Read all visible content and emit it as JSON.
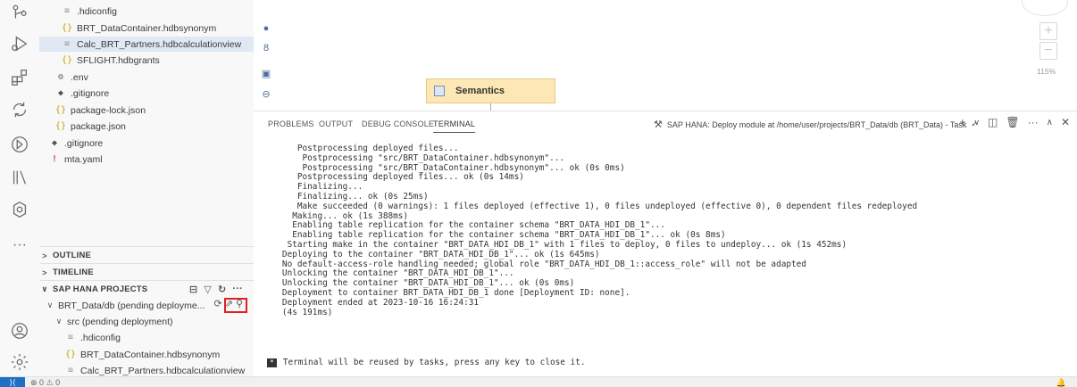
{
  "explorer": {
    "top_items": [
      {
        "icon": "≡",
        "kind": "gen",
        "label": ".hdiconfig"
      },
      {
        "icon": "{}",
        "kind": "json",
        "label": "BRT_DataContainer.hdbsynonym"
      },
      {
        "icon": "≡",
        "kind": "gen",
        "label": "Calc_BRT_Partners.hdbcalculationview"
      },
      {
        "icon": "{}",
        "kind": "json",
        "label": "SFLIGHT.hdbgrants"
      },
      {
        "icon": "⚙",
        "kind": "gear",
        "label": ".env"
      },
      {
        "icon": "◆",
        "kind": "diamond",
        "label": ".gitignore"
      },
      {
        "icon": "{}",
        "kind": "json",
        "label": "package-lock.json"
      },
      {
        "icon": "{}",
        "kind": "json",
        "label": "package.json"
      },
      {
        "icon": "◆",
        "kind": "diamond",
        "label": ".gitignore"
      },
      {
        "icon": "!",
        "kind": "excl",
        "label": "mta.yaml"
      }
    ],
    "outline_label": "OUTLINE",
    "timeline_label": "TIMELINE",
    "sap_hana_label": "SAP HANA PROJECTS",
    "project_label": "BRT_Data/db (pending deployme...",
    "src_label": "src (pending deployment)",
    "bottom_items": [
      {
        "icon": "≡",
        "kind": "gen",
        "label": ".hdiconfig"
      },
      {
        "icon": "{}",
        "kind": "json",
        "label": "BRT_DataContainer.hdbsynonym"
      },
      {
        "icon": "≡",
        "kind": "gen",
        "label": "Calc_BRT_Partners.hdbcalculationview"
      }
    ]
  },
  "canvas": {
    "semantics_label": "Semantics",
    "zoom_level": "115%"
  },
  "panel": {
    "tabs": [
      "PROBLEMS",
      "OUTPUT",
      "DEBUG CONSOLE",
      "TERMINAL"
    ],
    "active_tab": "TERMINAL",
    "task_title": "SAP HANA: Deploy module at /home/user/projects/BRT_Data/db (BRT_Data) - Task"
  },
  "terminal": {
    "lines": [
      "      Postprocessing deployed files...",
      "       Postprocessing \"src/BRT_DataContainer.hdbsynonym\"...",
      "       Postprocessing \"src/BRT_DataContainer.hdbsynonym\"... ok (0s 0ms)",
      "      Postprocessing deployed files... ok (0s 14ms)",
      "      Finalizing...",
      "      Finalizing... ok (0s 25ms)",
      "      Make succeeded (0 warnings): 1 files deployed (effective 1), 0 files undeployed (effective 0), 0 dependent files redeployed",
      "     Making... ok (1s 388ms)",
      "     Enabling table replication for the container schema \"BRT_DATA_HDI_DB_1\"...",
      "     Enabling table replication for the container schema \"BRT_DATA_HDI_DB_1\"... ok (0s 8ms)",
      "    Starting make in the container \"BRT_DATA_HDI_DB_1\" with 1 files to deploy, 0 files to undeploy... ok (1s 452ms)",
      "   Deploying to the container \"BRT_DATA_HDI_DB_1\"... ok (1s 645ms)",
      "   No default-access-role handling needed; global role \"BRT_DATA_HDI_DB_1::access_role\" will not be adapted",
      "   Unlocking the container \"BRT_DATA_HDI_DB_1\"...",
      "   Unlocking the container \"BRT_DATA_HDI_DB_1\"... ok (0s 0ms)",
      "   Deployment to container BRT_DATA_HDI_DB_1 done [Deployment ID: none].",
      "   Deployment ended at 2023-10-16 16:24:31",
      "   (4s 191ms)"
    ],
    "final_message": "Terminal will be reused by tasks, press any key to close it."
  },
  "statusbar": {
    "left_text": "⊗ 0 ⚠ 0"
  }
}
